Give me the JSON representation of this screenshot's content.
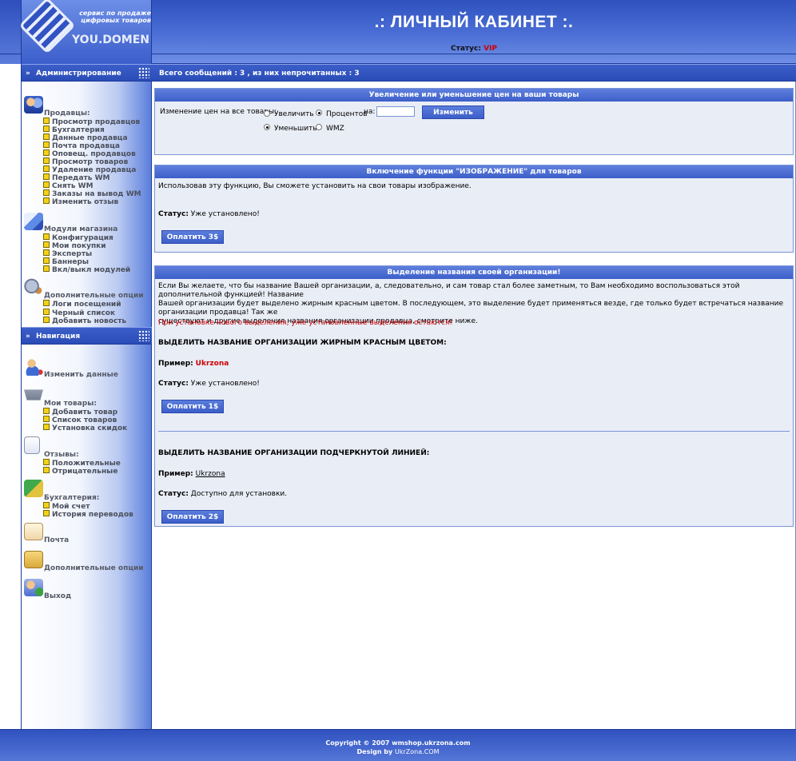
{
  "logo": {
    "tagline_line1": "сервис по продаже",
    "tagline_line2": "цифровых товаров",
    "brand": "YOU.DOMEN"
  },
  "header": {
    "title": ".: ЛИЧНЫЙ КАБИНЕТ :.",
    "status_label": "Статус:",
    "status_value": "VIP"
  },
  "messages_bar": "Всего сообщений : 3 , из них непрочитанных : 3",
  "sidebar": {
    "admin_header": "Администрирование",
    "sellers": {
      "title": "Продавцы:",
      "items": [
        "Просмотр продавцов",
        "Бухгалтерия",
        "Данные продавца",
        "Почта продавца",
        "Оповещ. продавцов",
        "Просмотр товаров",
        "Удаление продавца",
        "Передать WM",
        "Снять WM",
        "Заказы на вывод WM",
        "Изменить отзыв"
      ]
    },
    "modules": {
      "title": "Модули магазина",
      "items": [
        "Конфигурация",
        "Мои покупки",
        "Эксперты",
        "Баннеры",
        "Вкл/выкл модулей"
      ]
    },
    "extra_admin": {
      "title": "Дополнительные опции",
      "items": [
        "Логи посещений",
        "Черный список",
        "Добавить новость"
      ]
    },
    "nav_header": "Навигация",
    "change_data": "Изменить данные",
    "my_goods": {
      "title": "Мои товары:",
      "items": [
        "Добавить товар",
        "Список товаров",
        "Установка скидок"
      ]
    },
    "reviews": {
      "title": "Отзывы:",
      "items": [
        "Положительные",
        "Отрицательные"
      ]
    },
    "accounting": {
      "title": "Бухгалтерия:",
      "items": [
        "Мой счет",
        "История переводов"
      ]
    },
    "mail": "Почта",
    "extra_options": "Дополнительные опции",
    "exit": "Выход"
  },
  "price_panel": {
    "title": "Увеличение или уменьшение цен на ваши товары",
    "label": "Изменение цен на все товары:",
    "increase": "Увеличить",
    "decrease": "Уменьшить",
    "percent": "Процентов",
    "wmz": "WMZ",
    "on_label": "на:",
    "input_value": "",
    "button": "Изменить"
  },
  "image_panel": {
    "title": "Включение функции \"ИЗОБРАЖЕНИЕ\" для товаров",
    "description": "Использовав эту функцию, Вы сможете установить на свои товары изображение.",
    "status_label": "Статус:",
    "status_value": "Уже установлено!",
    "button": "Оплатить 3$"
  },
  "org_panel": {
    "title": "Выделение названия своей организации!",
    "description_l1": "Если Вы желаете, что бы название Вашей организации, а, следовательно, и сам товар стал более заметным, то Вам необходимо воспользоваться этой дополнительной функцией! Название",
    "description_l2": "Вашей организации будет выделено жирным красным цветом. В последующем, это выделение будет применяться везде, где только будет встречаться название организации продавца! Так же",
    "description_l3": "существуют и другие выделения названия организации продавца, смотрите ниже.",
    "warning": "При установке нового выделения, уже установленные выделения остаются!",
    "option1_title": "ВЫДЕЛИТЬ НАЗВАНИЕ ОРГАНИЗАЦИИ ЖИРНЫМ КРАСНЫМ ЦВЕТОМ:",
    "example_label": "Пример:",
    "example_value": "Ukrzona",
    "status_label": "Статус:",
    "option1_status": "Уже установлено!",
    "option1_button": "Оплатить 1$",
    "option2_title": "ВЫДЕЛИТЬ НАЗВАНИЕ ОРГАНИЗАЦИИ ПОДЧЕРКНУТОЙ ЛИНИЕЙ:",
    "option2_status": "Доступно для установки.",
    "option2_button": "Оплатить 2$"
  },
  "footer": {
    "copyright": "Copyright © 2007 wmshop.ukrzona.com",
    "design_label": "Design by",
    "design_brand": "UkrZona.COM"
  },
  "colors": {
    "header_blue": "#3d5fc9",
    "panel_bg": "#e9edf6",
    "accent_red": "#cc0000",
    "bullet_yellow": "#f1d21a"
  }
}
